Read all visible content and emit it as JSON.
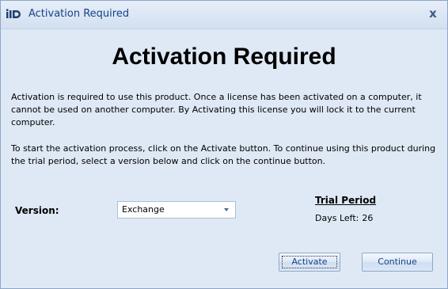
{
  "window": {
    "title": "Activation Required",
    "app_icon": "logo-icon",
    "close_icon": "close-icon",
    "close_glyph": "x"
  },
  "main": {
    "heading": "Activation Required",
    "paragraph1": "Activation is required to use this product.  Once a license has been activated on a computer, it cannot be used on another computer.  By Activating this license you will lock it to the current computer.",
    "paragraph2": "To start the activation process, click on the Activate button.  To continue using this product during the trial period, select a version below and click on the continue button."
  },
  "version": {
    "label": "Version:",
    "selected": "Exchange",
    "dropdown_icon": "chevron-down-icon"
  },
  "trial": {
    "heading": "Trial Period",
    "days_left_label": "Days Left:",
    "days_left_value": "26"
  },
  "buttons": {
    "activate_label": "Activate",
    "continue_label": "Continue"
  },
  "colors": {
    "window_background": "#dfe9f5",
    "title_text": "#15428b",
    "button_text": "#15428b",
    "logo_accent": "#1f3f6e"
  }
}
